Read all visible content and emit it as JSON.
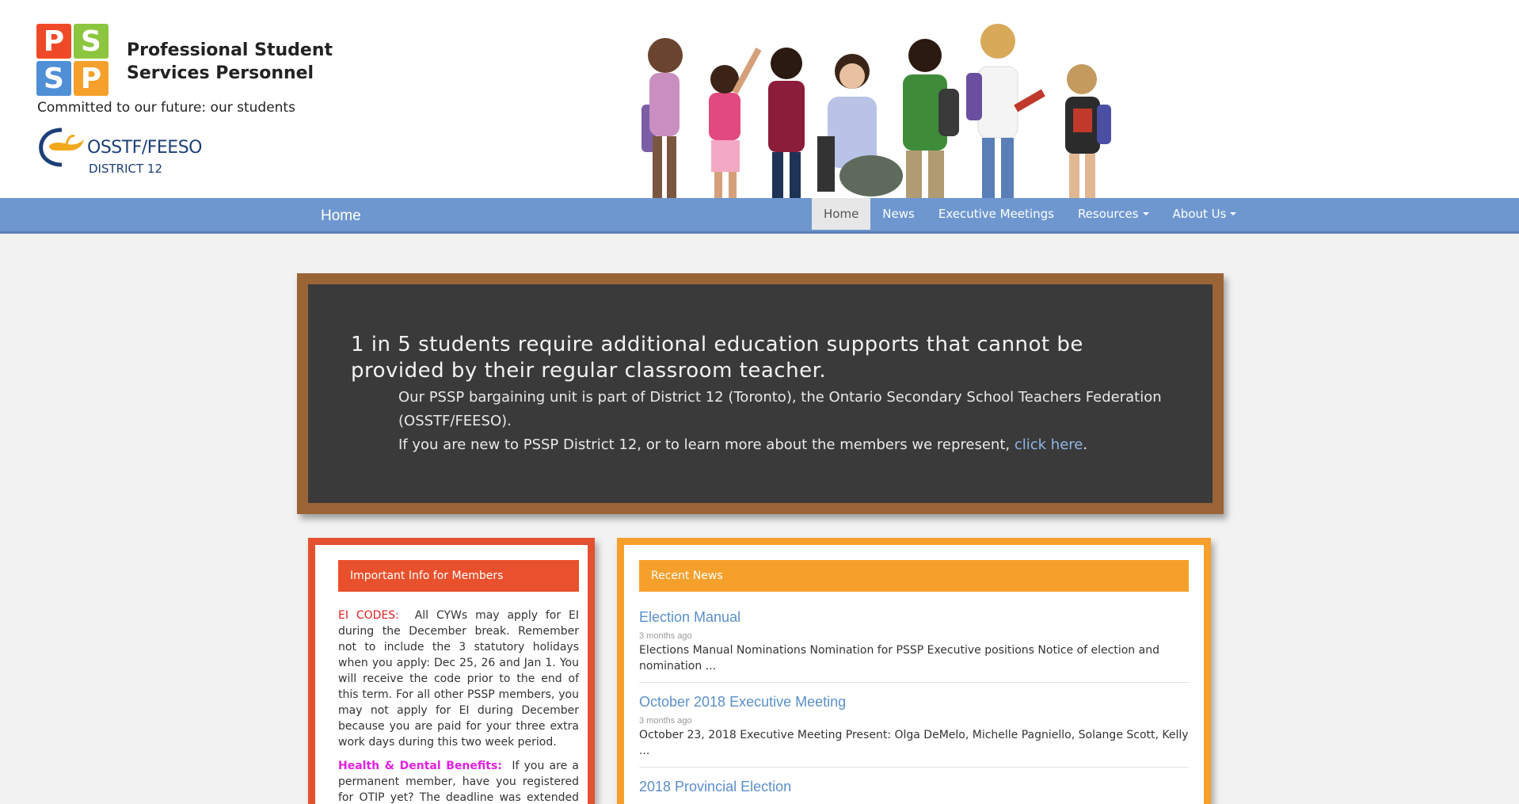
{
  "header": {
    "logo_letters": [
      "P",
      "S",
      "S",
      "P"
    ],
    "logo_colors": [
      "#ef4a27",
      "#8cc63f",
      "#4f8fd6",
      "#f6a02c"
    ],
    "org_line1": "Professional Student",
    "org_line2": "Services Personnel",
    "tagline": "Committed to our future: our students",
    "osstf_name": "OSSTF/FEESO",
    "osstf_district": "DISTRICT 12"
  },
  "navbar": {
    "brand": "Home",
    "items": [
      {
        "label": "Home",
        "active": true
      },
      {
        "label": "News"
      },
      {
        "label": "Executive Meetings"
      },
      {
        "label": "Resources",
        "dropdown": true
      },
      {
        "label": "About Us",
        "dropdown": true
      }
    ]
  },
  "chalkboard": {
    "headline": "1 in 5 students require additional education supports that cannot be provided by their regular classroom teacher.",
    "para1": "Our PSSP bargaining unit is part of District 12 (Toronto), the Ontario Secondary School Teachers Federation (OSSTF/FEESO).",
    "para2_prefix": "If you are new to PSSP District 12, or to learn more about the members we represent, ",
    "link_text": "click here",
    "para2_suffix": "."
  },
  "important_info": {
    "title": "Important Info for Members",
    "ei_label": "EI CODES:",
    "ei_text": "All CYWs may apply for EI during the December break.  Remember not to include the 3 statutory holidays when you apply: Dec 25, 26 and Jan 1.  You will receive the code prior to the end of this term.  For all other PSSP members, you may not apply for EI during December because you are paid for your three extra work days during this two week period.",
    "hd_label": "Health & Dental Benefits:",
    "hd_text": "If you are a permanent member, have you registered for OTIP yet?  The deadline was extended but you"
  },
  "recent_news": {
    "title": "Recent News",
    "items": [
      {
        "title": "Election Manual",
        "time": "3 months ago",
        "excerpt": "Elections Manual   Nominations   Nomination for PSSP Executive positions Notice of election and nomination ..."
      },
      {
        "title": "October 2018 Executive Meeting",
        "time": "3 months ago",
        "excerpt": "October 23, 2018 Executive Meeting   Present:          Olga DeMelo, Michelle Pagniello, Solange Scott, Kelly ..."
      },
      {
        "title": "2018 Provincial Election",
        "time": "",
        "excerpt": ""
      }
    ]
  }
}
